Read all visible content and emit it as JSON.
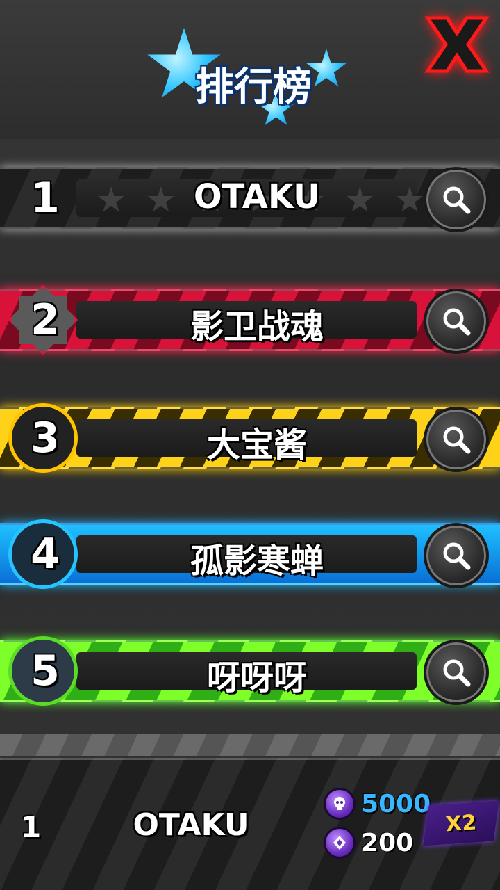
{
  "header": {
    "title": "排行榜",
    "close_icon": "close-x-icon"
  },
  "leaderboard": [
    {
      "rank": "1",
      "name": "OTAKU",
      "theme": "silver"
    },
    {
      "rank": "2",
      "name": "影卫战魂",
      "theme": "red"
    },
    {
      "rank": "3",
      "name": "大宝酱",
      "theme": "yellow"
    },
    {
      "rank": "4",
      "name": "孤影寒蝉",
      "theme": "blue"
    },
    {
      "rank": "5",
      "name": "呀呀呀",
      "theme": "green"
    }
  ],
  "my_entry": {
    "rank": "1",
    "name": "OTAKU",
    "rewards": [
      {
        "icon": "purple-skull-coin-icon",
        "value": "5000"
      },
      {
        "icon": "purple-gem-coin-icon",
        "value": "200"
      }
    ],
    "multiplier": "X2"
  },
  "colors": {
    "red": "#e0143c",
    "yellow": "#ffc400",
    "blue": "#25c4ff",
    "green": "#5bdc27",
    "close": "#ff1a1a",
    "title_glow": "#2aa8ff"
  }
}
